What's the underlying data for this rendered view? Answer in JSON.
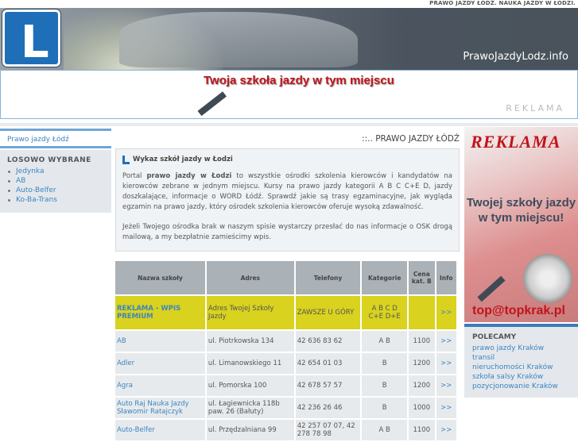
{
  "top_tagline": "PRAWO JAZDY ŁÓDŹ. NAUKA JAZDY W ŁODZI.",
  "logo": {
    "letter": "L"
  },
  "site_name": "PrawoJazdyLodz.info",
  "banner_ad": {
    "text": "Twoja szkoła jazdy w tym miejscu",
    "label": "REKLAMA"
  },
  "sidebar": {
    "nav_link": "Prawo jazdy Łódź",
    "random_heading": "LOSOWO WYBRANE",
    "random_items": [
      "Jedynka",
      "AB",
      "Auto-Belfer",
      "Ko-Ba-Trans"
    ]
  },
  "main": {
    "page_title": "::.. PRAWO JAZDY ŁÓDŹ",
    "intro_heading": "Wykaz szkół jazdy w Łodzi",
    "intro_p1_before": "Portal ",
    "intro_p1_bold": "prawo jazdy w Łodzi",
    "intro_p1_after": " to wszystkie ośrodki szkolenia kierowców i kandydatów na kierowców zebrane w jednym miejscu. Kursy na prawo jazdy kategorii A B C C+E D, jazdy doszkalające, informacje o WORD Łódź. Sprawdź jakie są trasy egzaminacyjne, jak wygląda egzamin na prawo jazdy, który ośrodek szkolenia kierowców oferuje wysoką zdawalność.",
    "intro_p2": "Jeżeli Twojego ośrodka brak w naszym spisie wystarczy przesłać do nas informacje o OSK drogą mailową, a my bezpłatnie zamieścimy wpis.",
    "table": {
      "headers": [
        "Nazwa szkoły",
        "Adres",
        "Telefony",
        "Kategorie",
        "Cena kat. B",
        "Info"
      ],
      "rows": [
        {
          "name": "REKLAMA - WPIS PREMIUM",
          "address": "Adres Twojej Szkoły Jazdy",
          "phone": "ZAWSZE U GÓRY",
          "categories": "A B C D C+E D+E",
          "price": "",
          "info": ">>"
        },
        {
          "name": "AB",
          "address": "ul. Piotrkowska 134",
          "phone": "42 636 83 62",
          "categories": "A B",
          "price": "1100",
          "info": ">>"
        },
        {
          "name": "Adler",
          "address": "ul. Limanowskiego 11",
          "phone": "42 654 01 03",
          "categories": "B",
          "price": "1200",
          "info": ">>"
        },
        {
          "name": "Agra",
          "address": "ul. Pomorska 100",
          "phone": "42 678 57 57",
          "categories": "B",
          "price": "1200",
          "info": ">>"
        },
        {
          "name": "Auto Raj Nauka Jazdy Sławomir Ratajczyk",
          "address": "ul. Łagiewnicka 118b paw. 26 (Bałuty)",
          "phone": "42 236 26 46",
          "categories": "B",
          "price": "1000",
          "info": ">>"
        },
        {
          "name": "Auto-Belfer",
          "address": "ul. Przędzalniana 99",
          "phone": "42 257 07 07, 42 278 78 98",
          "categories": "A B",
          "price": "1100",
          "info": ">>"
        }
      ]
    }
  },
  "right_ad": {
    "label": "REKLAMA",
    "text": "Twojej szkoły jazdy w tym miejscu!",
    "email": "top@topkrak.pl"
  },
  "polecamy": {
    "heading": "POLECAMY",
    "links": [
      "prawo jazdy Kraków",
      "transil",
      "nieruchomości Kraków",
      "szkoła salsy Kraków",
      "pozycjonowanie Kraków"
    ]
  }
}
